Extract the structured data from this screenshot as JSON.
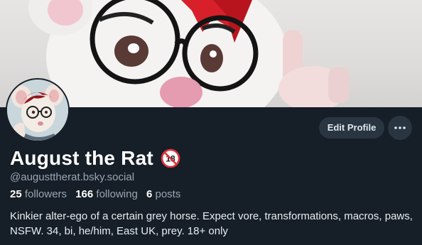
{
  "profile": {
    "display_name": "August the Rat",
    "handle": "@augusttherat.bsky.social",
    "followers_count": "25",
    "followers_label": "followers",
    "following_count": "166",
    "following_label": "following",
    "posts_count": "6",
    "posts_label": "posts",
    "bio": "Kinkier alter-ego of a certain grey horse. Expect vore, transformations, macros, paws, NSFW. 34, bi, he/him, East UK, prey. 18+ only"
  },
  "actions": {
    "edit_profile_label": "Edit Profile",
    "more_icon": "ellipsis-icon"
  },
  "badges": {
    "adult_badge_icon": "no-under-18-icon",
    "adult_badge_text": "18"
  },
  "colors": {
    "background": "#161e27",
    "button_bg": "#2a3542",
    "secondary_text": "#9aa6b3",
    "badge_red": "#e0323c"
  }
}
